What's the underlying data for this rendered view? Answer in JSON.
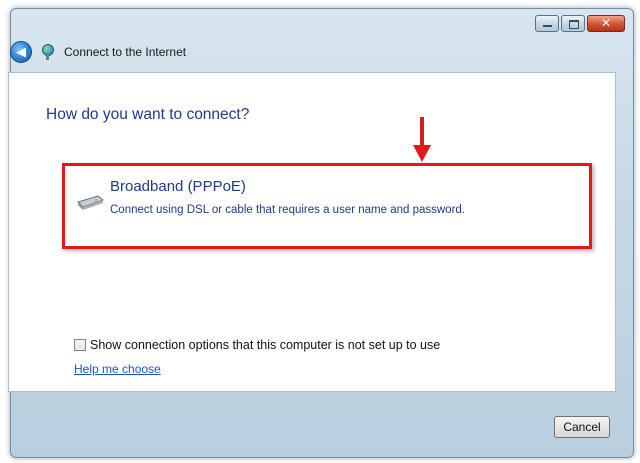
{
  "window": {
    "title": "Connect to the Internet",
    "close_glyph": "✕",
    "back_glyph": "◀"
  },
  "main": {
    "heading": "How do you want to connect?",
    "option": {
      "title": "Broadband (PPPoE)",
      "description": "Connect using DSL or cable that requires a user name and password.",
      "icon": "modem-icon"
    },
    "show_options_label": "Show connection options that this computer is not set up to use",
    "help_link": "Help me choose"
  },
  "footer": {
    "cancel_label": "Cancel"
  },
  "colors": {
    "highlight": "#e01a1a",
    "heading_blue": "#1e3a8c",
    "link_blue": "#1c55c7"
  }
}
